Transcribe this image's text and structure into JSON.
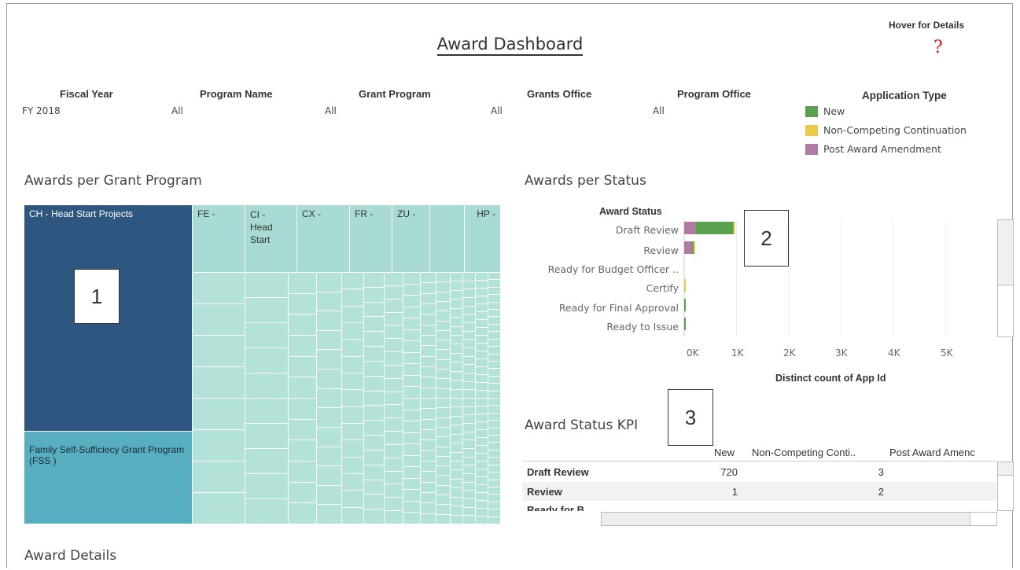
{
  "header": {
    "title": "Award Dashboard",
    "hover_label": "Hover for Details",
    "help_glyph": "?"
  },
  "filters": [
    {
      "label": "Fiscal Year",
      "value": "FY 2018"
    },
    {
      "label": "Program Name",
      "value": "All"
    },
    {
      "label": "Grant Program",
      "value": "All"
    },
    {
      "label": "Grants Office",
      "value": "All"
    },
    {
      "label": "Program Office",
      "value": "All"
    }
  ],
  "fiscal_all": "All",
  "legend": {
    "title": "Application Type",
    "items": [
      {
        "label": "New",
        "color": "#59a14f"
      },
      {
        "label": "Non-Competing Continuation",
        "color": "#edc948"
      },
      {
        "label": "Post Award Amendment",
        "color": "#b07aa1"
      }
    ]
  },
  "treemap": {
    "title": "Awards per Grant Program",
    "cells": [
      "CH - Head Start Projects",
      "Family Self-Sufficiecy Grant Program (FSS )",
      "FE -",
      "CI - Head Start",
      "CX -",
      "FR -",
      "ZU -",
      "HP -"
    ]
  },
  "status_chart": {
    "title": "Awards per Status",
    "axis_header": "Award Status",
    "xlabel": "Distinct count of App Id",
    "categories": [
      "Draft Review",
      "Review",
      "Ready for Budget Officer ..",
      "Certify",
      "Ready for Final Approval",
      "Ready to Issue"
    ],
    "ticks": [
      "0K",
      "1K",
      "2K",
      "3K",
      "4K",
      "5K"
    ]
  },
  "chart_data": {
    "type": "bar",
    "title": "Awards per Status",
    "xlabel": "Distinct count of App Id",
    "ylabel": "Award Status",
    "categories": [
      "Draft Review",
      "Review",
      "Ready for Budget Officer ..",
      "Certify",
      "Ready for Final Approval",
      "Ready to Issue"
    ],
    "series": [
      {
        "name": "Post Award Amendment",
        "color": "#b07aa1",
        "values": [
          220,
          150,
          0,
          0,
          0,
          0
        ]
      },
      {
        "name": "New",
        "color": "#59a14f",
        "values": [
          720,
          1,
          0,
          0,
          30,
          30
        ]
      },
      {
        "name": "Non-Competing Continuation",
        "color": "#edc948",
        "values": [
          3,
          2,
          0,
          30,
          0,
          0
        ]
      }
    ],
    "xlim": [
      0,
      5800
    ],
    "orientation": "horizontal"
  },
  "kpi": {
    "title": "Award Status KPI",
    "columns": [
      "New",
      "Non-Competing Conti..",
      "Post Award Amenc"
    ],
    "rows": [
      {
        "status": "Draft Review",
        "new": "720",
        "ncc": "3"
      },
      {
        "status": "Review",
        "new": "1",
        "ncc": "2"
      },
      {
        "status": "Ready for B...",
        "new": "",
        "ncc": ""
      }
    ]
  },
  "details": {
    "title": "Award Details"
  },
  "callouts": [
    "1",
    "2",
    "3"
  ]
}
